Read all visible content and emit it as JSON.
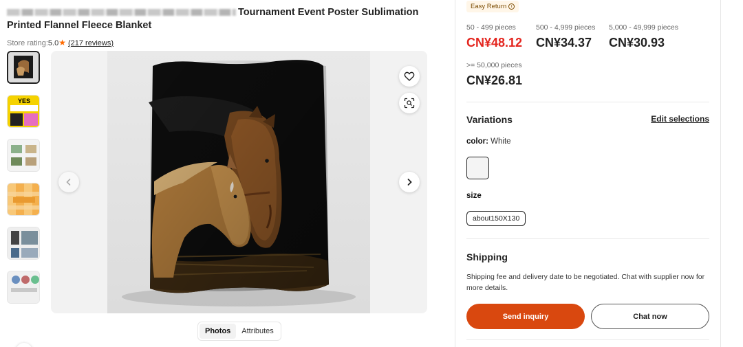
{
  "product": {
    "title_line1": "Tournament Event Poster Sublimation",
    "title_line2": "Printed Flannel Fleece Blanket",
    "rating_label": "Store rating:",
    "rating_value": "5.0",
    "reviews": "(217 reviews)"
  },
  "gallery": {
    "thumbnails": [
      {
        "name": "thumb-horse-blanket"
      },
      {
        "name": "thumb-yes-custom"
      },
      {
        "name": "thumb-custom-print"
      },
      {
        "name": "thumb-cotton-bag"
      },
      {
        "name": "thumb-display"
      },
      {
        "name": "thumb-more"
      }
    ],
    "tabs": [
      {
        "label": "Photos",
        "active": true
      },
      {
        "label": "Attributes",
        "active": false
      }
    ]
  },
  "panel": {
    "badge": "Easy Return",
    "tiers": [
      {
        "qty": "50 - 499 pieces",
        "price": "CN¥48.12"
      },
      {
        "qty": "500 - 4,999 pieces",
        "price": "CN¥34.37"
      },
      {
        "qty": "5,000 - 49,999 pieces",
        "price": "CN¥30.93"
      },
      {
        "qty": ">= 50,000 pieces",
        "price": "CN¥26.81"
      }
    ],
    "variations_title": "Variations",
    "edit_selections": "Edit selections",
    "color_label": "color:",
    "color_value": "White",
    "size_label": "size",
    "size_option": "about150X130",
    "shipping_title": "Shipping",
    "shipping_text": "Shipping fee and delivery date to be negotiated. Chat with supplier now for more details.",
    "send_inquiry": "Send inquiry",
    "chat_now": "Chat now"
  },
  "colors": {
    "price_red": "#e4261f",
    "accent_orange": "#d9480f",
    "star": "#ff6a00"
  }
}
